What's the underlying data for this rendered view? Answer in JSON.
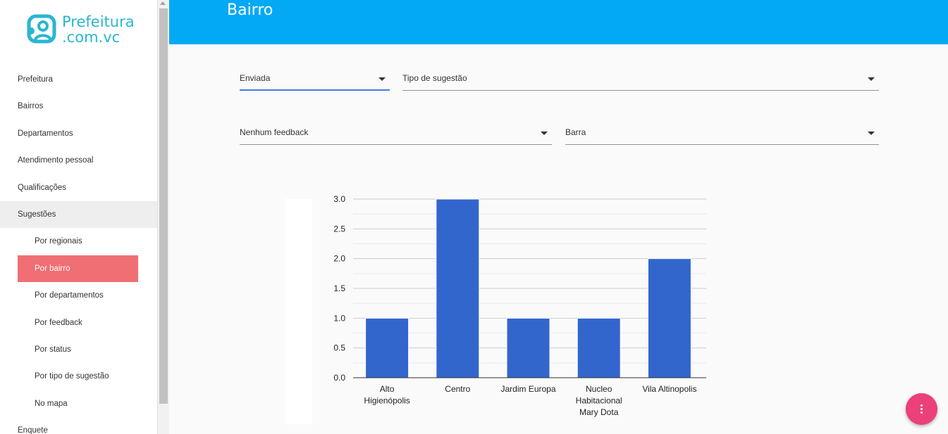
{
  "brand": {
    "line1": "Prefeitura",
    "line2": ".com.vc",
    "color": "#29b6d1"
  },
  "sidebar": {
    "items": [
      {
        "label": "Prefeitura"
      },
      {
        "label": "Bairros"
      },
      {
        "label": "Departamentos"
      },
      {
        "label": "Atendimento pessoal"
      },
      {
        "label": "Qualificações"
      },
      {
        "label": "Sugestões"
      }
    ],
    "subitems": [
      {
        "label": "Por regionais"
      },
      {
        "label": "Por bairro"
      },
      {
        "label": "Por departamentos"
      },
      {
        "label": "Por feedback"
      },
      {
        "label": "Por status"
      },
      {
        "label": "Por tipo de sugestão"
      },
      {
        "label": "No mapa"
      }
    ],
    "after": {
      "label": "Enquete"
    }
  },
  "header": {
    "title": "Bairro",
    "color": "#03a9f4"
  },
  "filters": {
    "status": "Enviada",
    "type": "Tipo de sugestão",
    "feedback": "Nenhum feedback",
    "chart_type": "Barra"
  },
  "chart_data": {
    "type": "bar",
    "categories": [
      [
        "Alto",
        "Higienópolis"
      ],
      [
        "Centro"
      ],
      [
        "Jardim Europa"
      ],
      [
        "Nucleo",
        "Habitacional",
        "Mary Dota"
      ],
      [
        "Vila Altinopolis"
      ]
    ],
    "values": [
      1,
      3,
      1,
      1,
      2
    ],
    "ylim": [
      0,
      3
    ],
    "yticks": [
      "0.0",
      "0.5",
      "1.0",
      "1.5",
      "2.0",
      "2.5",
      "3.0"
    ],
    "color": "#3366cc",
    "grid": true
  },
  "fab": {
    "icon": "more-vert-icon",
    "color": "#ec407a"
  }
}
